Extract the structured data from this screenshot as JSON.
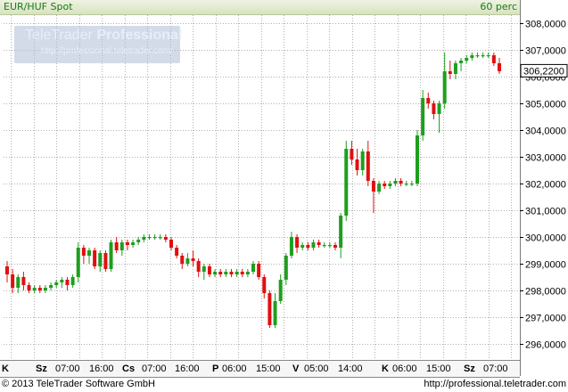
{
  "header": {
    "title": "EUR/HUF Spot",
    "interval": "60 perc"
  },
  "watermark": {
    "brand_light": "TeleTrader",
    "brand_bold": "Professional",
    "url": "http://professional.teletrader.com/"
  },
  "footer": {
    "copyright": "© 2013 TeleTrader Software GmbH",
    "url": "http://professional.teletrader.com"
  },
  "colors": {
    "up": "#1f9e1f",
    "down": "#e01010",
    "grid": "#b0b0b0",
    "header_text": "#1a7a1a"
  },
  "chart_data": {
    "type": "candlestick",
    "ylim": [
      295.4,
      308.3
    ],
    "y_ticks": [
      296.0,
      297.0,
      298.0,
      299.0,
      300.0,
      301.0,
      302.0,
      303.0,
      304.0,
      305.0,
      306.0,
      307.0,
      308.0
    ],
    "y_tick_labels": [
      "296,0000",
      "297,0000",
      "298,0000",
      "299,0000",
      "300,0000",
      "301,0000",
      "302,0000",
      "303,0000",
      "304,0000",
      "305,0000",
      "306,0000",
      "307,0000",
      "308,0000"
    ],
    "last_value": 306.22,
    "last_value_label": "306,2200",
    "x_labels": [
      {
        "text": "K",
        "day": true
      },
      {
        "text": "Sz",
        "day": true
      },
      {
        "text": "07:00",
        "day": false
      },
      {
        "text": "16:00",
        "day": false
      },
      {
        "text": "Cs",
        "day": true
      },
      {
        "text": "07:00",
        "day": false
      },
      {
        "text": "16:00",
        "day": false
      },
      {
        "text": "P",
        "day": true
      },
      {
        "text": "06:00",
        "day": false
      },
      {
        "text": "15:00",
        "day": false
      },
      {
        "text": "V",
        "day": true
      },
      {
        "text": "05:00",
        "day": false
      },
      {
        "text": "14:00",
        "day": false
      },
      {
        "text": "K",
        "day": true
      },
      {
        "text": "06:00",
        "day": false
      },
      {
        "text": "15:00",
        "day": false
      },
      {
        "text": "Sz",
        "day": true
      },
      {
        "text": "07:00",
        "day": false
      }
    ],
    "candles": [
      [
        298.9,
        299.1,
        298.3,
        298.6
      ],
      [
        298.6,
        298.8,
        297.9,
        298.1
      ],
      [
        298.1,
        298.6,
        297.9,
        298.5
      ],
      [
        298.5,
        298.7,
        298.0,
        298.2
      ],
      [
        298.2,
        298.3,
        297.9,
        298.0
      ],
      [
        298.0,
        298.2,
        297.9,
        298.1
      ],
      [
        298.1,
        298.2,
        297.9,
        298.0
      ],
      [
        298.0,
        298.2,
        297.9,
        298.1
      ],
      [
        298.1,
        298.3,
        298.0,
        298.2
      ],
      [
        298.2,
        298.4,
        298.1,
        298.3
      ],
      [
        298.3,
        298.5,
        298.1,
        298.4
      ],
      [
        298.4,
        298.5,
        298.0,
        298.2
      ],
      [
        298.2,
        298.6,
        298.1,
        298.5
      ],
      [
        298.5,
        299.8,
        298.3,
        299.6
      ],
      [
        299.6,
        299.7,
        299.0,
        299.3
      ],
      [
        299.3,
        299.6,
        299.0,
        299.5
      ],
      [
        299.5,
        299.6,
        298.8,
        298.9
      ],
      [
        298.9,
        299.5,
        298.7,
        299.4
      ],
      [
        299.4,
        299.5,
        298.7,
        298.8
      ],
      [
        298.8,
        299.9,
        298.7,
        299.8
      ],
      [
        299.8,
        300.0,
        299.4,
        299.5
      ],
      [
        299.5,
        299.9,
        299.3,
        299.8
      ],
      [
        299.8,
        299.9,
        299.5,
        299.7
      ],
      [
        299.7,
        299.9,
        299.6,
        299.8
      ],
      [
        299.8,
        300.0,
        299.7,
        299.9
      ],
      [
        299.9,
        300.1,
        299.8,
        300.0
      ],
      [
        300.0,
        300.1,
        299.9,
        300.0
      ],
      [
        300.0,
        300.1,
        299.9,
        300.0
      ],
      [
        300.0,
        300.1,
        299.9,
        300.0
      ],
      [
        300.0,
        300.1,
        299.8,
        299.9
      ],
      [
        299.9,
        300.0,
        299.5,
        299.6
      ],
      [
        299.6,
        299.7,
        299.2,
        299.3
      ],
      [
        299.3,
        299.4,
        298.8,
        299.0
      ],
      [
        299.0,
        299.4,
        298.9,
        299.2
      ],
      [
        299.2,
        299.5,
        298.9,
        299.1
      ],
      [
        299.1,
        299.2,
        298.5,
        298.7
      ],
      [
        298.7,
        299.0,
        298.4,
        298.9
      ],
      [
        298.9,
        299.0,
        298.5,
        298.6
      ],
      [
        298.6,
        298.8,
        298.5,
        298.7
      ],
      [
        298.7,
        298.8,
        298.5,
        298.6
      ],
      [
        298.6,
        298.8,
        298.5,
        298.7
      ],
      [
        298.7,
        298.8,
        298.5,
        298.6
      ],
      [
        298.6,
        298.8,
        298.5,
        298.7
      ],
      [
        298.7,
        298.8,
        298.5,
        298.6
      ],
      [
        298.6,
        298.8,
        298.5,
        298.7
      ],
      [
        298.7,
        299.1,
        298.6,
        299.0
      ],
      [
        299.0,
        299.1,
        298.4,
        298.5
      ],
      [
        298.5,
        298.6,
        297.7,
        297.9
      ],
      [
        297.9,
        298.0,
        296.6,
        296.7
      ],
      [
        296.7,
        297.9,
        296.6,
        297.6
      ],
      [
        297.6,
        298.6,
        297.5,
        298.4
      ],
      [
        298.4,
        299.4,
        298.2,
        299.3
      ],
      [
        299.3,
        300.2,
        299.2,
        300.0
      ],
      [
        300.0,
        300.1,
        299.4,
        299.6
      ],
      [
        299.6,
        299.8,
        299.5,
        299.7
      ],
      [
        299.7,
        299.8,
        299.5,
        299.6
      ],
      [
        299.6,
        299.9,
        299.5,
        299.8
      ],
      [
        299.8,
        299.9,
        299.6,
        299.7
      ],
      [
        299.7,
        299.8,
        299.6,
        299.7
      ],
      [
        299.7,
        299.8,
        299.6,
        299.7
      ],
      [
        299.7,
        299.8,
        299.5,
        299.6
      ],
      [
        299.6,
        300.9,
        299.2,
        300.8
      ],
      [
        300.8,
        303.6,
        300.6,
        303.3
      ],
      [
        303.3,
        303.6,
        302.7,
        302.9
      ],
      [
        302.9,
        303.3,
        302.3,
        302.5
      ],
      [
        302.5,
        303.3,
        302.3,
        303.2
      ],
      [
        303.2,
        303.6,
        301.9,
        302.1
      ],
      [
        302.1,
        302.2,
        300.9,
        301.7
      ],
      [
        301.7,
        302.1,
        301.6,
        302.0
      ],
      [
        302.0,
        302.1,
        301.8,
        301.9
      ],
      [
        301.9,
        302.1,
        301.8,
        302.0
      ],
      [
        302.0,
        302.2,
        301.9,
        302.1
      ],
      [
        302.1,
        302.2,
        301.9,
        302.0
      ],
      [
        302.0,
        302.1,
        301.9,
        302.0
      ],
      [
        302.0,
        302.1,
        301.9,
        302.0
      ],
      [
        302.0,
        304.0,
        301.9,
        303.8
      ],
      [
        303.8,
        305.5,
        303.6,
        305.2
      ],
      [
        305.2,
        305.4,
        304.8,
        305.0
      ],
      [
        305.0,
        305.1,
        304.4,
        304.6
      ],
      [
        304.6,
        305.1,
        303.9,
        305.0
      ],
      [
        305.0,
        306.9,
        304.8,
        306.2
      ],
      [
        306.2,
        306.6,
        305.9,
        306.1
      ],
      [
        306.1,
        306.6,
        305.9,
        306.5
      ],
      [
        306.5,
        306.7,
        306.2,
        306.6
      ],
      [
        306.6,
        306.8,
        306.5,
        306.7
      ],
      [
        306.7,
        306.9,
        306.6,
        306.8
      ],
      [
        306.8,
        306.9,
        306.7,
        306.8
      ],
      [
        306.8,
        306.9,
        306.7,
        306.8
      ],
      [
        306.8,
        306.9,
        306.7,
        306.8
      ],
      [
        306.8,
        306.9,
        306.4,
        306.5
      ],
      [
        306.5,
        306.7,
        306.1,
        306.2
      ]
    ]
  }
}
